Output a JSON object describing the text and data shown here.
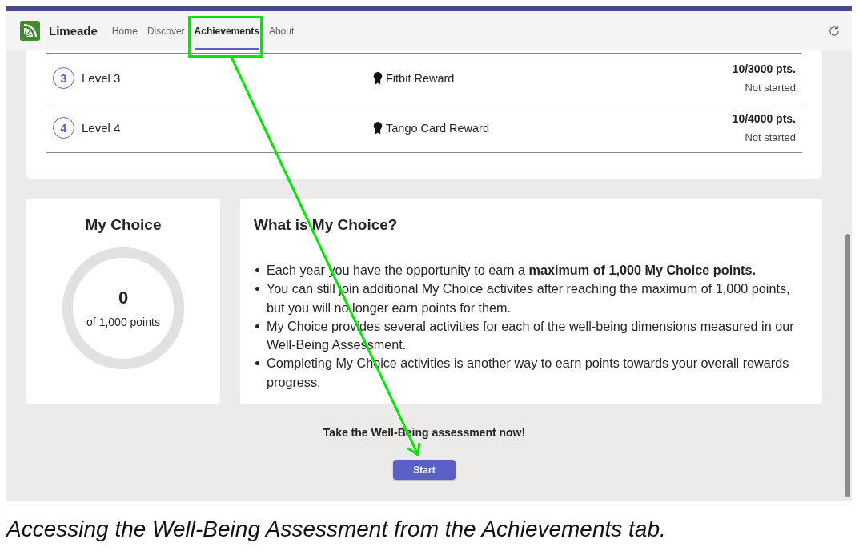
{
  "app_header": {
    "app_name": "Limeade",
    "tabs": [
      {
        "label": "Home",
        "selected": false,
        "highlighted": false
      },
      {
        "label": "Discover",
        "selected": false,
        "highlighted": false
      },
      {
        "label": "Achievements",
        "selected": true,
        "highlighted": true
      },
      {
        "label": "About",
        "selected": false,
        "highlighted": false
      }
    ]
  },
  "levels": [
    {
      "number": "3",
      "name": "Level 3",
      "reward": "Fitbit Reward",
      "points": "10/3000 pts.",
      "status": "Not started"
    },
    {
      "number": "4",
      "name": "Level 4",
      "reward": "Tango Card Reward",
      "points": "10/4000 pts.",
      "status": "Not started"
    }
  ],
  "my_choice": {
    "title": "My Choice",
    "value": "0",
    "caption": "of 1,000 points"
  },
  "info": {
    "title": "What is My Choice?",
    "bullets": [
      "Each year you have the opportunity to earn a **maximum of 1,000 My Choice points.**",
      "You can still join additional My Choice activites after reaching the maximum of 1,000 points, but you will no longer earn points for them.",
      "My Choice provides several activities for each of the well-being dimensions measured in our Well-Being Assessment.",
      "Completing My Choice activities is another way to earn points towards your overall rewards progress."
    ]
  },
  "cta": {
    "prompt": "Take the Well-Being assessment now!",
    "button": {
      "label": "Start",
      "arrow_target": true
    }
  },
  "caption": "Accessing the Well-Being Assessment from the Achievements tab."
}
